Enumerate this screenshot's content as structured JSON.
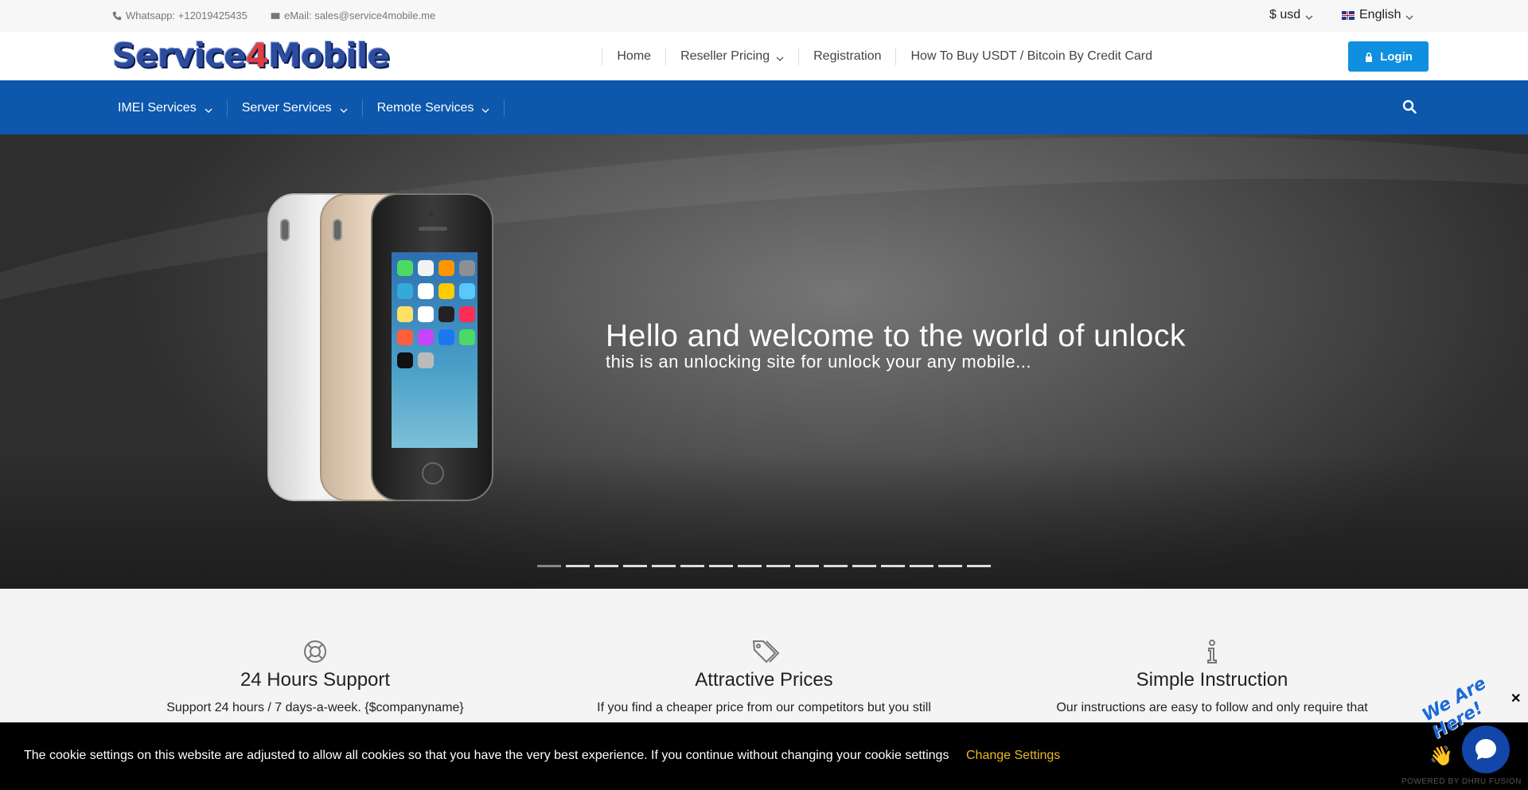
{
  "topbar": {
    "whatsapp": "Whatsapp: +12019425435",
    "email": "eMail: sales@service4mobile.me",
    "currency": "$ usd",
    "language": "English"
  },
  "header": {
    "logo_text_a": "Service",
    "logo_text_b": "4",
    "logo_text_c": "Mobile",
    "nav": {
      "home": "Home",
      "reseller": "Reseller Pricing",
      "registration": "Registration",
      "howto": "How To Buy USDT / Bitcoin By Credit Card"
    },
    "login": "Login"
  },
  "bluenav": {
    "imei": "IMEI Services",
    "server": "Server Services",
    "remote": "Remote Services"
  },
  "hero": {
    "title": "Hello and welcome to the world of unlock",
    "subtitle": "this is an unlocking site for unlock your any mobile...",
    "slide_count": 16,
    "active_slide": 1
  },
  "features": [
    {
      "icon": "lifebuoy-icon",
      "title": "24 Hours Support",
      "text": "Support 24 hours / 7 days-a-week. {$companyname}"
    },
    {
      "icon": "tags-icon",
      "title": "Attractive Prices",
      "text": "If you find a cheaper price from our competitors but you still"
    },
    {
      "icon": "info-icon",
      "title": "Simple Instruction",
      "text": "Our instructions are easy to follow and only require that"
    }
  ],
  "cookie": {
    "text": "The cookie settings on this website are adjusted to allow all cookies so that you have the very best experience. If you continue without changing your cookie settings",
    "link": "Change Settings",
    "close": "✕"
  },
  "chat": {
    "badge": "We Are Here!",
    "powered": "POWERED BY DHRU FUSION"
  },
  "colors": {
    "nav_blue": "#0d57ad",
    "login_blue": "#0f8fdf",
    "cookie_link": "#e9b82a"
  }
}
